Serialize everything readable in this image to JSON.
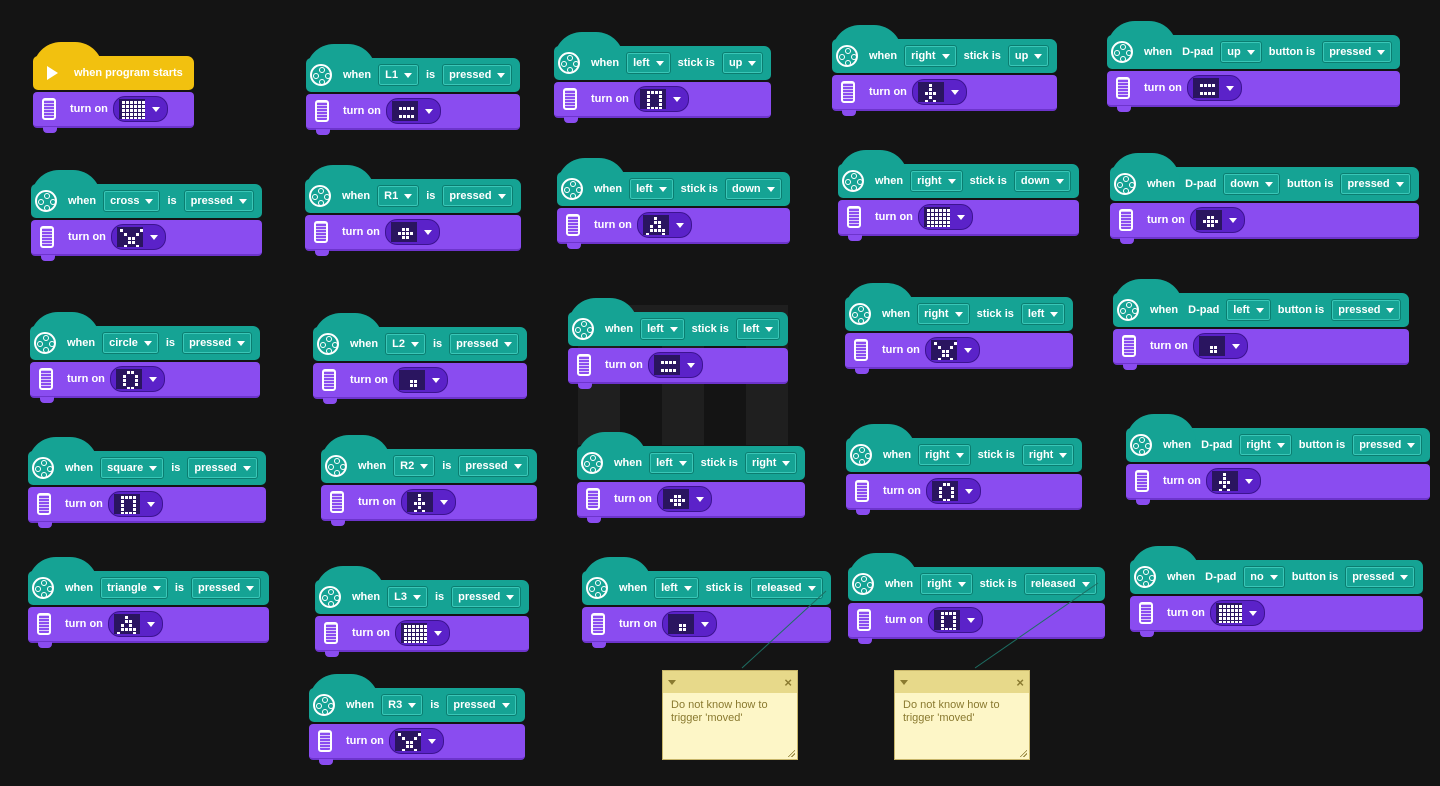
{
  "colors": {
    "event": "#15a394",
    "start": "#f2c10f",
    "command": "#8a4cf0",
    "background": "#141414",
    "note": "#fdf6c7"
  },
  "start_block": {
    "label": "when program starts",
    "cmd_label": "turn on",
    "icon": "play-icon"
  },
  "words": {
    "when": "when",
    "is": "is",
    "stick_is": "stick is",
    "dpad": "D-pad",
    "button_is": "button is",
    "turn_on": "turn on"
  },
  "button_blocks": [
    {
      "button": "cross",
      "state": "pressed"
    },
    {
      "button": "circle",
      "state": "pressed"
    },
    {
      "button": "square",
      "state": "pressed"
    },
    {
      "button": "triangle",
      "state": "pressed"
    },
    {
      "button": "L1",
      "state": "pressed"
    },
    {
      "button": "R1",
      "state": "pressed"
    },
    {
      "button": "L2",
      "state": "pressed"
    },
    {
      "button": "R2",
      "state": "pressed"
    },
    {
      "button": "L3",
      "state": "pressed"
    },
    {
      "button": "R3",
      "state": "pressed"
    }
  ],
  "stick_blocks": [
    {
      "stick": "left",
      "direction": "up"
    },
    {
      "stick": "left",
      "direction": "down"
    },
    {
      "stick": "left",
      "direction": "left"
    },
    {
      "stick": "left",
      "direction": "right"
    },
    {
      "stick": "left",
      "direction": "released"
    },
    {
      "stick": "right",
      "direction": "up"
    },
    {
      "stick": "right",
      "direction": "down"
    },
    {
      "stick": "right",
      "direction": "left"
    },
    {
      "stick": "right",
      "direction": "right"
    },
    {
      "stick": "right",
      "direction": "released"
    }
  ],
  "dpad_blocks": [
    {
      "direction": "up",
      "state": "pressed"
    },
    {
      "direction": "down",
      "state": "pressed"
    },
    {
      "direction": "left",
      "state": "pressed"
    },
    {
      "direction": "right",
      "state": "pressed"
    },
    {
      "direction": "no",
      "state": "pressed"
    }
  ],
  "notes": [
    {
      "text": "Do not know how to trigger 'moved'"
    },
    {
      "text": "Do not know how to trigger 'moved'"
    }
  ]
}
